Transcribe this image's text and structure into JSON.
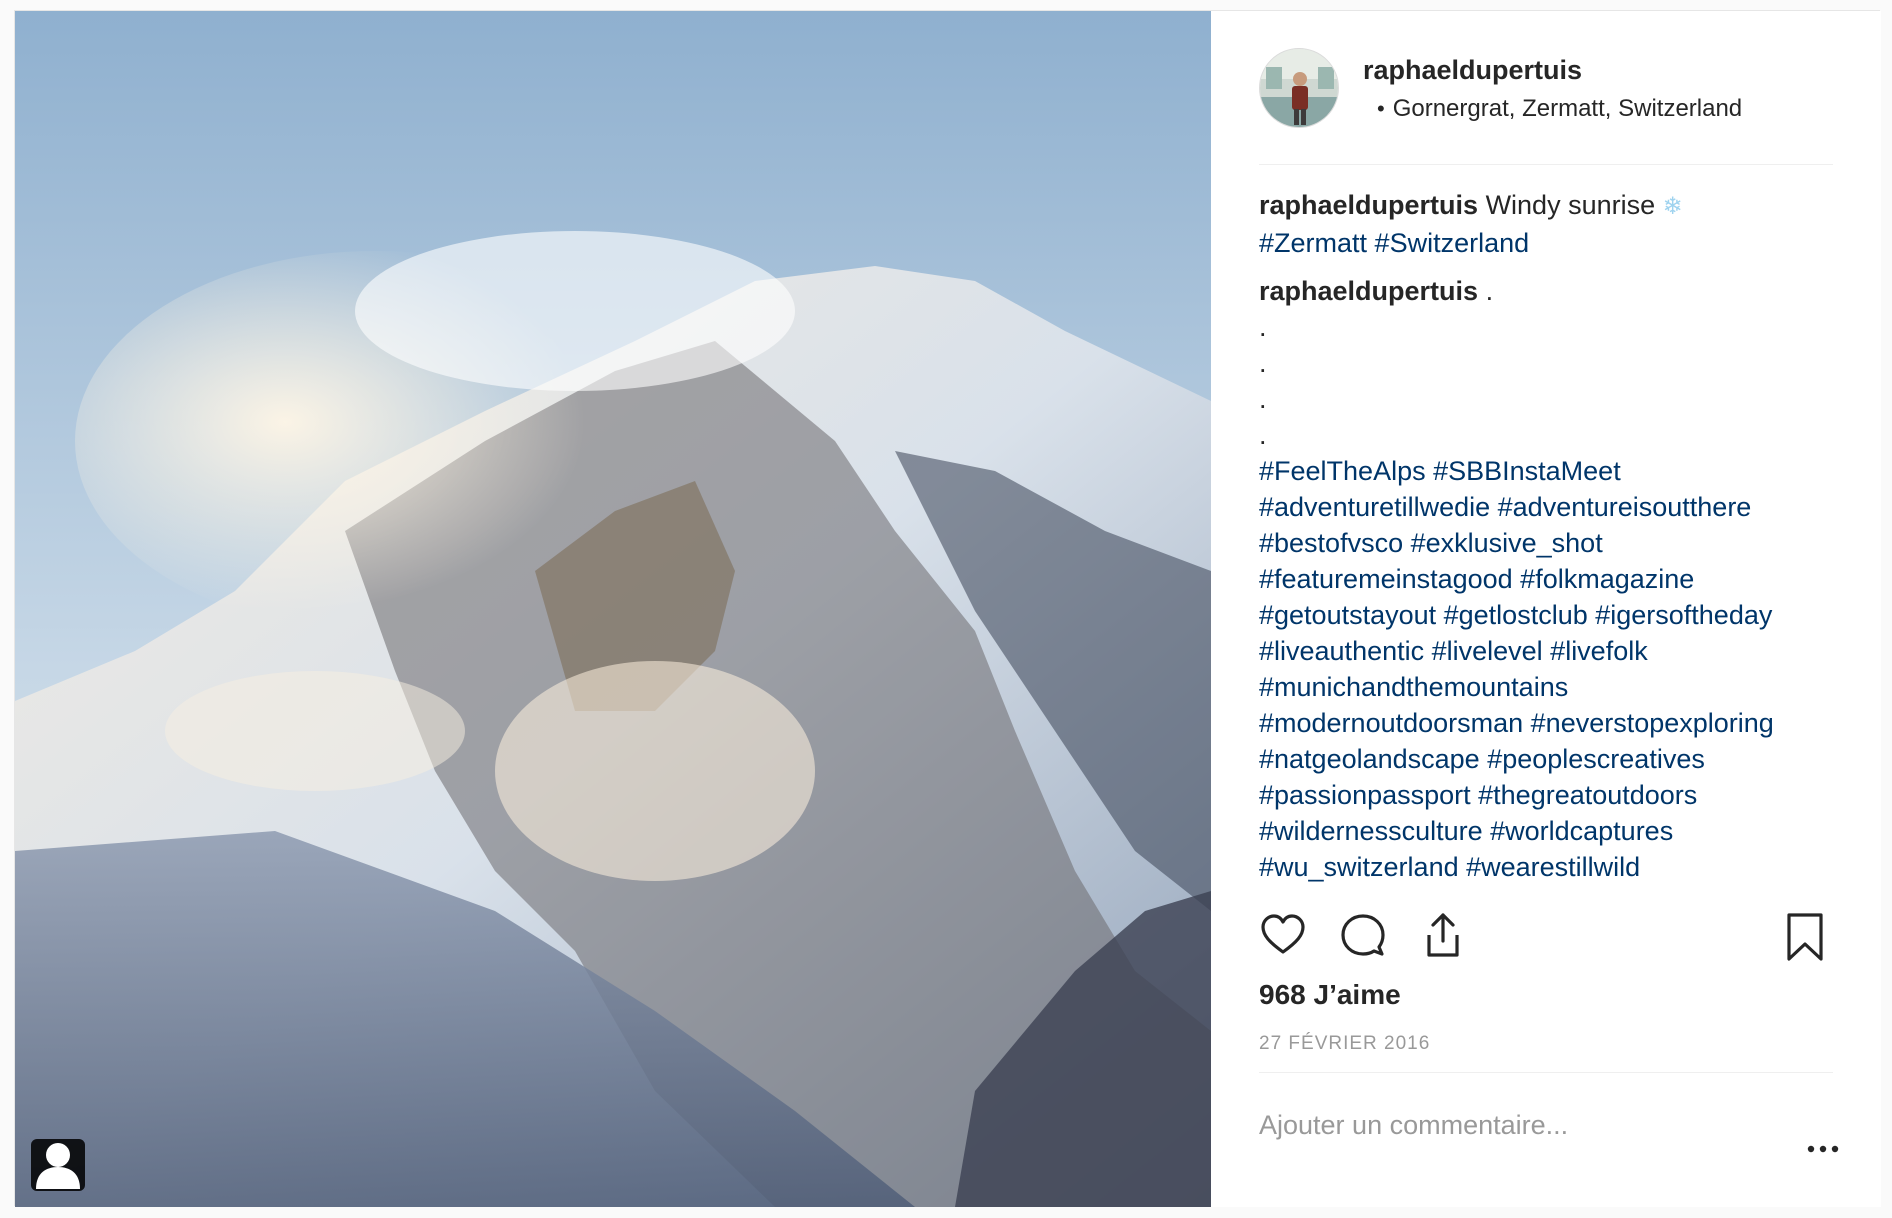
{
  "post": {
    "username": "raphaeldupertuis",
    "location": "Gornergrat, Zermatt, Switzerland",
    "location_bullet": "•",
    "caption": {
      "username": "raphaeldupertuis",
      "text": "Windy sunrise",
      "emoji": "❄",
      "hashtags": [
        "#Zermatt",
        "#Switzerland"
      ]
    },
    "comment": {
      "username": "raphaeldupertuis",
      "first_line": ".",
      "dots": [
        ".",
        ".",
        ".",
        "."
      ],
      "hashtag_lines": [
        "#FeelTheAlps #SBBInstaMeet",
        "#adventuretillwedie #adventureisoutthere",
        "#bestofvsco #exklusive_shot",
        "#featuremeinstagood #folkmagazine",
        "#getoutstayout #getlostclub #igersoftheday",
        "#liveauthentic #livelevel #livefolk",
        "#munichandthemountains",
        "#modernoutdoorsman #neverstopexploring",
        "#natgeolandscape #peoplescreatives",
        "#passionpassport #thegreatoutdoors",
        "#wildernessculture #worldcaptures",
        "#wu_switzerland #wearestillwild"
      ]
    },
    "likes": "968 J’aime",
    "date": "27 FÉVRIER 2016",
    "comment_placeholder": "Ajouter un commentaire..."
  },
  "icons": {
    "like": "heart-icon",
    "comment": "comment-bubble-icon",
    "share": "share-icon",
    "save": "bookmark-icon",
    "more": "more-dots-icon",
    "user_tag": "user-tag-icon"
  },
  "colors": {
    "hashtag": "#003569",
    "text": "#262626",
    "muted": "#999999",
    "border": "#efefef"
  }
}
